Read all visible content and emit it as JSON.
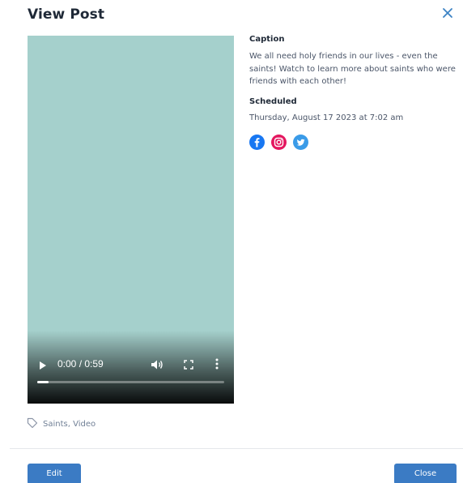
{
  "modal": {
    "title": "View Post",
    "close_icon": "close-icon"
  },
  "video": {
    "background_color": "#a5d0cc",
    "time_display": "0:00 / 0:59",
    "progress": 0,
    "icons": [
      "play-icon",
      "volume-icon",
      "fullscreen-icon",
      "more-options-icon"
    ]
  },
  "caption": {
    "label": "Caption",
    "text": "We all need holy friends in our lives - even the saints! Watch to learn more about saints who were friends with each other!"
  },
  "schedule": {
    "label": "Scheduled",
    "value": "Thursday, August 17 2023 at 7:02 am"
  },
  "platforms": [
    {
      "name": "facebook-icon",
      "color": "#1877f2"
    },
    {
      "name": "instagram-icon",
      "color": "#e4175f"
    },
    {
      "name": "twitter-icon",
      "color": "#3a9be8"
    }
  ],
  "tags": {
    "icon": "tag-icon",
    "text": "Saints, Video"
  },
  "footer": {
    "edit_label": "Edit",
    "close_label": "Close"
  },
  "colors": {
    "accent": "#3b7bc4"
  }
}
